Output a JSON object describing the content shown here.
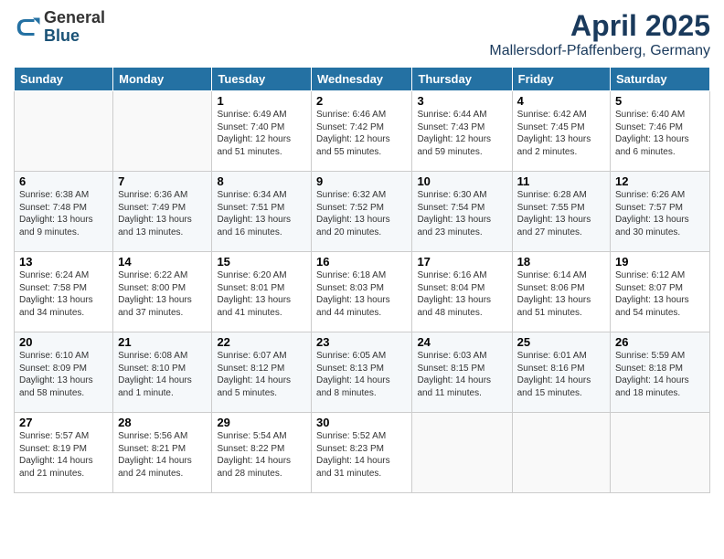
{
  "header": {
    "logo_general": "General",
    "logo_blue": "Blue",
    "month_title": "April 2025",
    "location": "Mallersdorf-Pfaffenberg, Germany"
  },
  "days_of_week": [
    "Sunday",
    "Monday",
    "Tuesday",
    "Wednesday",
    "Thursday",
    "Friday",
    "Saturday"
  ],
  "weeks": [
    [
      {
        "day": "",
        "info": ""
      },
      {
        "day": "",
        "info": ""
      },
      {
        "day": "1",
        "info": "Sunrise: 6:49 AM\nSunset: 7:40 PM\nDaylight: 12 hours and 51 minutes."
      },
      {
        "day": "2",
        "info": "Sunrise: 6:46 AM\nSunset: 7:42 PM\nDaylight: 12 hours and 55 minutes."
      },
      {
        "day": "3",
        "info": "Sunrise: 6:44 AM\nSunset: 7:43 PM\nDaylight: 12 hours and 59 minutes."
      },
      {
        "day": "4",
        "info": "Sunrise: 6:42 AM\nSunset: 7:45 PM\nDaylight: 13 hours and 2 minutes."
      },
      {
        "day": "5",
        "info": "Sunrise: 6:40 AM\nSunset: 7:46 PM\nDaylight: 13 hours and 6 minutes."
      }
    ],
    [
      {
        "day": "6",
        "info": "Sunrise: 6:38 AM\nSunset: 7:48 PM\nDaylight: 13 hours and 9 minutes."
      },
      {
        "day": "7",
        "info": "Sunrise: 6:36 AM\nSunset: 7:49 PM\nDaylight: 13 hours and 13 minutes."
      },
      {
        "day": "8",
        "info": "Sunrise: 6:34 AM\nSunset: 7:51 PM\nDaylight: 13 hours and 16 minutes."
      },
      {
        "day": "9",
        "info": "Sunrise: 6:32 AM\nSunset: 7:52 PM\nDaylight: 13 hours and 20 minutes."
      },
      {
        "day": "10",
        "info": "Sunrise: 6:30 AM\nSunset: 7:54 PM\nDaylight: 13 hours and 23 minutes."
      },
      {
        "day": "11",
        "info": "Sunrise: 6:28 AM\nSunset: 7:55 PM\nDaylight: 13 hours and 27 minutes."
      },
      {
        "day": "12",
        "info": "Sunrise: 6:26 AM\nSunset: 7:57 PM\nDaylight: 13 hours and 30 minutes."
      }
    ],
    [
      {
        "day": "13",
        "info": "Sunrise: 6:24 AM\nSunset: 7:58 PM\nDaylight: 13 hours and 34 minutes."
      },
      {
        "day": "14",
        "info": "Sunrise: 6:22 AM\nSunset: 8:00 PM\nDaylight: 13 hours and 37 minutes."
      },
      {
        "day": "15",
        "info": "Sunrise: 6:20 AM\nSunset: 8:01 PM\nDaylight: 13 hours and 41 minutes."
      },
      {
        "day": "16",
        "info": "Sunrise: 6:18 AM\nSunset: 8:03 PM\nDaylight: 13 hours and 44 minutes."
      },
      {
        "day": "17",
        "info": "Sunrise: 6:16 AM\nSunset: 8:04 PM\nDaylight: 13 hours and 48 minutes."
      },
      {
        "day": "18",
        "info": "Sunrise: 6:14 AM\nSunset: 8:06 PM\nDaylight: 13 hours and 51 minutes."
      },
      {
        "day": "19",
        "info": "Sunrise: 6:12 AM\nSunset: 8:07 PM\nDaylight: 13 hours and 54 minutes."
      }
    ],
    [
      {
        "day": "20",
        "info": "Sunrise: 6:10 AM\nSunset: 8:09 PM\nDaylight: 13 hours and 58 minutes."
      },
      {
        "day": "21",
        "info": "Sunrise: 6:08 AM\nSunset: 8:10 PM\nDaylight: 14 hours and 1 minute."
      },
      {
        "day": "22",
        "info": "Sunrise: 6:07 AM\nSunset: 8:12 PM\nDaylight: 14 hours and 5 minutes."
      },
      {
        "day": "23",
        "info": "Sunrise: 6:05 AM\nSunset: 8:13 PM\nDaylight: 14 hours and 8 minutes."
      },
      {
        "day": "24",
        "info": "Sunrise: 6:03 AM\nSunset: 8:15 PM\nDaylight: 14 hours and 11 minutes."
      },
      {
        "day": "25",
        "info": "Sunrise: 6:01 AM\nSunset: 8:16 PM\nDaylight: 14 hours and 15 minutes."
      },
      {
        "day": "26",
        "info": "Sunrise: 5:59 AM\nSunset: 8:18 PM\nDaylight: 14 hours and 18 minutes."
      }
    ],
    [
      {
        "day": "27",
        "info": "Sunrise: 5:57 AM\nSunset: 8:19 PM\nDaylight: 14 hours and 21 minutes."
      },
      {
        "day": "28",
        "info": "Sunrise: 5:56 AM\nSunset: 8:21 PM\nDaylight: 14 hours and 24 minutes."
      },
      {
        "day": "29",
        "info": "Sunrise: 5:54 AM\nSunset: 8:22 PM\nDaylight: 14 hours and 28 minutes."
      },
      {
        "day": "30",
        "info": "Sunrise: 5:52 AM\nSunset: 8:23 PM\nDaylight: 14 hours and 31 minutes."
      },
      {
        "day": "",
        "info": ""
      },
      {
        "day": "",
        "info": ""
      },
      {
        "day": "",
        "info": ""
      }
    ]
  ]
}
